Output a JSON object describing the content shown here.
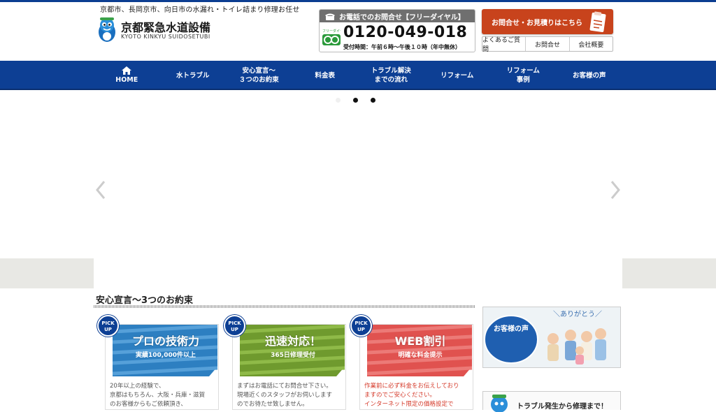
{
  "header": {
    "tagline": "京都市、長岡京市、向日市の水漏れ・トイレ詰まり修理お任せ",
    "logo_jp": "京都緊急水道設備",
    "logo_en": "KYOTO KINKYU SUIDOSETUBI"
  },
  "phone": {
    "heading": "お電話でのお問合せ【フリーダイヤル】",
    "number": "0120-049-018",
    "hours": "受付時間：午前６時〜午後１０時（年中無休）",
    "freedial_label": "フリーダイヤル"
  },
  "contact": {
    "button_label": "お問合せ・お見積りはこちら",
    "links": [
      "よくあるご質問",
      "お問合せ",
      "会社概要"
    ]
  },
  "nav": {
    "items": [
      {
        "label": "HOME",
        "icon": "home-icon"
      },
      {
        "label": "水トラブル"
      },
      {
        "label": "安心宣言〜\n３つのお約束"
      },
      {
        "label": "料金表"
      },
      {
        "label": "トラブル解決\nまでの流れ"
      },
      {
        "label": "リフォーム"
      },
      {
        "label": "リフォーム\n事例"
      },
      {
        "label": "お客様の声"
      }
    ]
  },
  "slider": {
    "active_dot": 1,
    "dot_count": 3
  },
  "section": {
    "title": "安心宣言〜3つのお約束"
  },
  "cards": [
    {
      "badge": "PICK\nUP",
      "title": "プロの技術力",
      "subtitle": "実績100,000件以上",
      "text": "20年以上の経験で、\n京都はもちろん、大阪・兵庫・滋賀\nのお客様からもご依頼頂き、",
      "color": "#2d7fc1"
    },
    {
      "badge": "PICK\nUP",
      "title": "迅速対応！",
      "subtitle": "365日修理受付",
      "text": "まずはお電話にてお問合せ下さい。\n現場近くのスタッフがお伺いします\nのでお待たせ致しません。",
      "color": "#6f9a2e"
    },
    {
      "badge": "PICK\nUP",
      "title": "WEB割引",
      "subtitle": "明確な料金提示",
      "text": "作業前に必ず料金をお伝えしており\nますのでご安心ください。\nインターネット限定の価格設定で",
      "color": "#e0524f",
      "text_color": "red"
    }
  ],
  "sidebar": {
    "voice_bubble": "お客様の声",
    "voice_arigato": "ありがとう",
    "trouble_text": "トラブル発生から修理まで！"
  },
  "colors": {
    "nav_blue": "#0d3f94",
    "contact_orange": "#c8431c"
  }
}
